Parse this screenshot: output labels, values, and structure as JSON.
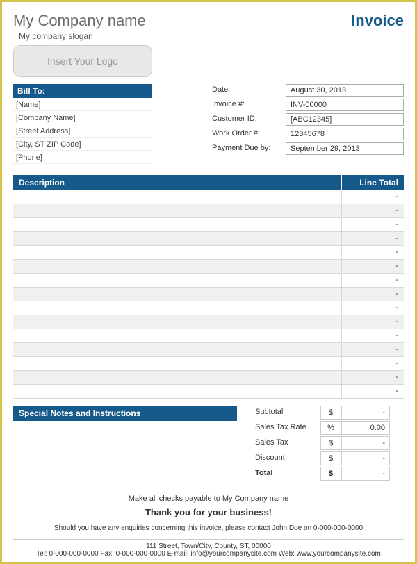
{
  "header": {
    "company_name": "My Company name",
    "invoice_title": "Invoice",
    "slogan": "My company slogan",
    "logo_placeholder": "Insert Your Logo"
  },
  "bill_to": {
    "header": "Bill To:",
    "name": "[Name]",
    "company": "[Company Name]",
    "street": "[Street Address]",
    "city": "[City, ST  ZIP Code]",
    "phone": "[Phone]"
  },
  "meta": {
    "date_label": "Date:",
    "date_value": "August 30, 2013",
    "invoice_label": "Invoice #:",
    "invoice_value": "INV-00000",
    "customer_label": "Customer ID:",
    "customer_value": "[ABC12345]",
    "workorder_label": "Work Order #:",
    "workorder_value": "12345678",
    "due_label": "Payment Due by:",
    "due_value": "September 29, 2013"
  },
  "lines": {
    "desc_header": "Description",
    "total_header": "Line Total",
    "empty": "-"
  },
  "notes": {
    "header": "Special Notes and Instructions"
  },
  "totals": {
    "subtotal_label": "Subtotal",
    "subtotal_sym": "$",
    "subtotal_val": "-",
    "taxrate_label": "Sales Tax Rate",
    "taxrate_sym": "%",
    "taxrate_val": "0.00",
    "salestax_label": "Sales Tax",
    "salestax_sym": "$",
    "salestax_val": "-",
    "discount_label": "Discount",
    "discount_sym": "$",
    "discount_val": "-",
    "total_label": "Total",
    "total_sym": "$",
    "total_val": "-"
  },
  "footer": {
    "payable": "Make all checks payable to My Company name",
    "thanks": "Thank you for your business!",
    "enquiries": "Should you have any enquiries concerning this invoice, please contact John Doe on 0-000-000-0000",
    "address": "111 Street, Town/City, County, ST, 00000",
    "contact": "Tel: 0-000-000-0000 Fax: 0-000-000-0000 E-mail: info@yourcompanysite.com Web: www.yourcompanysite.com"
  }
}
